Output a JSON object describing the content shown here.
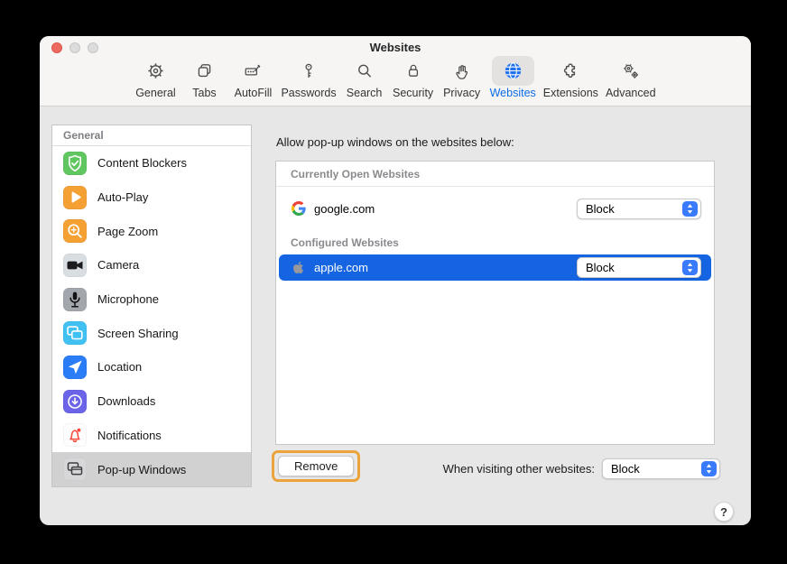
{
  "window": {
    "title": "Websites",
    "traffic_lights": [
      "close",
      "minimize",
      "zoom"
    ]
  },
  "toolbar": {
    "items": [
      {
        "name": "general",
        "label": "General",
        "icon": "gear-icon",
        "selected": false
      },
      {
        "name": "tabs",
        "label": "Tabs",
        "icon": "tabs-icon",
        "selected": false
      },
      {
        "name": "autofill",
        "label": "AutoFill",
        "icon": "autofill-icon",
        "selected": false
      },
      {
        "name": "passwords",
        "label": "Passwords",
        "icon": "key-icon",
        "selected": false
      },
      {
        "name": "search",
        "label": "Search",
        "icon": "magnifier-icon",
        "selected": false
      },
      {
        "name": "security",
        "label": "Security",
        "icon": "lock-icon",
        "selected": false
      },
      {
        "name": "privacy",
        "label": "Privacy",
        "icon": "hand-icon",
        "selected": false
      },
      {
        "name": "websites",
        "label": "Websites",
        "icon": "globe-icon",
        "selected": true
      },
      {
        "name": "extensions",
        "label": "Extensions",
        "icon": "puzzle-icon",
        "selected": false
      },
      {
        "name": "advanced",
        "label": "Advanced",
        "icon": "gears-icon",
        "selected": false
      }
    ]
  },
  "sidebar": {
    "header": "General",
    "items": [
      {
        "name": "content-blockers",
        "label": "Content Blockers",
        "icon": "shield-check-icon",
        "color": "#5fc660",
        "selected": false
      },
      {
        "name": "auto-play",
        "label": "Auto-Play",
        "icon": "play-icon",
        "color": "#f5a033",
        "selected": false
      },
      {
        "name": "page-zoom",
        "label": "Page Zoom",
        "icon": "zoom-plus-icon",
        "color": "#f5a033",
        "selected": false
      },
      {
        "name": "camera",
        "label": "Camera",
        "icon": "camera-icon",
        "color": "#d9dee3",
        "selected": false
      },
      {
        "name": "microphone",
        "label": "Microphone",
        "icon": "microphone-icon",
        "color": "#a2a7ad",
        "selected": false
      },
      {
        "name": "screen-sharing",
        "label": "Screen Sharing",
        "icon": "screens-icon",
        "color": "#41c0f2",
        "selected": false
      },
      {
        "name": "location",
        "label": "Location",
        "icon": "location-arrow-icon",
        "color": "#2a7cf7",
        "selected": false
      },
      {
        "name": "downloads",
        "label": "Downloads",
        "icon": "download-circle-icon",
        "color": "#6b63e8",
        "selected": false
      },
      {
        "name": "notifications",
        "label": "Notifications",
        "icon": "bell-icon",
        "color": "#fdfdfd",
        "selected": false
      },
      {
        "name": "pop-up-windows",
        "label": "Pop-up Windows",
        "icon": "popup-windows-icon",
        "color": "#d7d7d9",
        "selected": true
      }
    ]
  },
  "main": {
    "intro": "Allow pop-up windows on the websites below:",
    "list": {
      "sections": [
        {
          "header": "Currently Open Websites",
          "rows": [
            {
              "name": "google",
              "site": "google.com",
              "icon": "google-favicon",
              "value": "Block",
              "selected": false
            }
          ]
        },
        {
          "header": "Configured Websites",
          "rows": [
            {
              "name": "apple",
              "site": "apple.com",
              "icon": "apple-favicon",
              "value": "Block",
              "selected": true
            }
          ]
        }
      ]
    },
    "remove_button": "Remove",
    "footer": {
      "label": "When visiting other websites:",
      "value": "Block"
    },
    "help_button": "?"
  },
  "colors": {
    "accent_blue": "#0d6ce6",
    "selection_blue": "#1565e2",
    "stepper_blue": "#3a7bfd",
    "highlight_orange": "#eba43c",
    "selected_sidebar_gray": "#d2d1d1",
    "notification_red": "#fb4538",
    "window_chrome": "#f6f5f4",
    "content_background": "#e8e7e7"
  }
}
